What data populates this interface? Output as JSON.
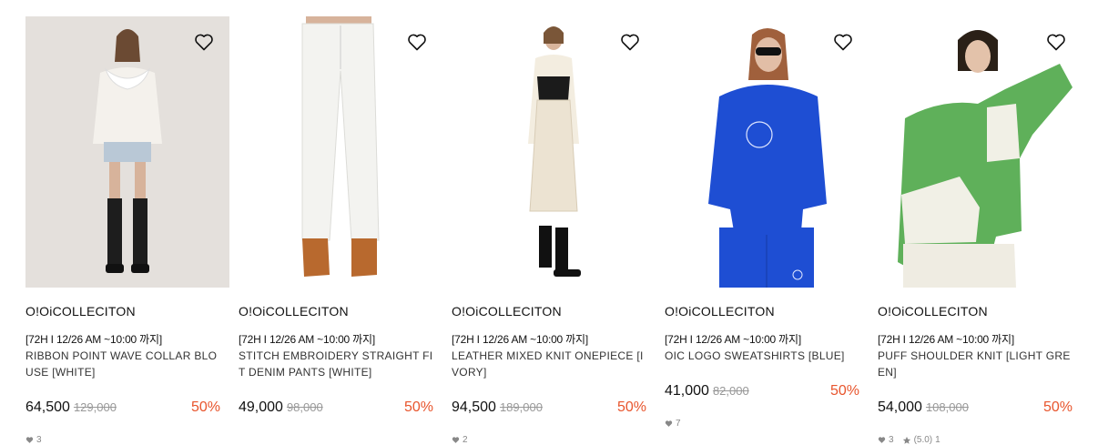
{
  "products": [
    {
      "brand": "O!OiCOLLECITON",
      "promo": "[72H I 12/26 AM ~10:00 까지]",
      "name": "RIBBON POINT WAVE COLLAR BLOUSE [WHITE]",
      "price": "64,500",
      "original_price": "129,000",
      "discount": "50%",
      "likes": "3",
      "rating": "",
      "reviews": ""
    },
    {
      "brand": "O!OiCOLLECITON",
      "promo": "[72H I 12/26 AM ~10:00 까지]",
      "name": "STITCH EMBROIDERY STRAIGHT FIT DENIM PANTS [WHITE]",
      "price": "49,000",
      "original_price": "98,000",
      "discount": "50%",
      "likes": "",
      "rating": "",
      "reviews": ""
    },
    {
      "brand": "O!OiCOLLECITON",
      "promo": "[72H I 12/26 AM ~10:00 까지]",
      "name": "LEATHER MIXED KNIT ONEPIECE [IVORY]",
      "price": "94,500",
      "original_price": "189,000",
      "discount": "50%",
      "likes": "2",
      "rating": "",
      "reviews": ""
    },
    {
      "brand": "O!OiCOLLECITON",
      "promo": "[72H I 12/26 AM ~10:00 까지]",
      "name": "OIC LOGO SWEATSHIRTS [BLUE]",
      "price": "41,000",
      "original_price": "82,000",
      "discount": "50%",
      "likes": "7",
      "rating": "",
      "reviews": ""
    },
    {
      "brand": "O!OiCOLLECITON",
      "promo": "[72H I 12/26 AM ~10:00 까지]",
      "name": "PUFF SHOULDER KNIT [LIGHT GREEN]",
      "price": "54,000",
      "original_price": "108,000",
      "discount": "50%",
      "likes": "3",
      "rating": "(5.0)",
      "reviews": "1"
    }
  ],
  "colors": {
    "discount": "#e8552d",
    "original_price": "#999999",
    "meta": "#888888"
  },
  "icons": {
    "wishlist": "heart-outline-icon",
    "likes": "heart-filled-icon",
    "rating": "star-icon"
  }
}
